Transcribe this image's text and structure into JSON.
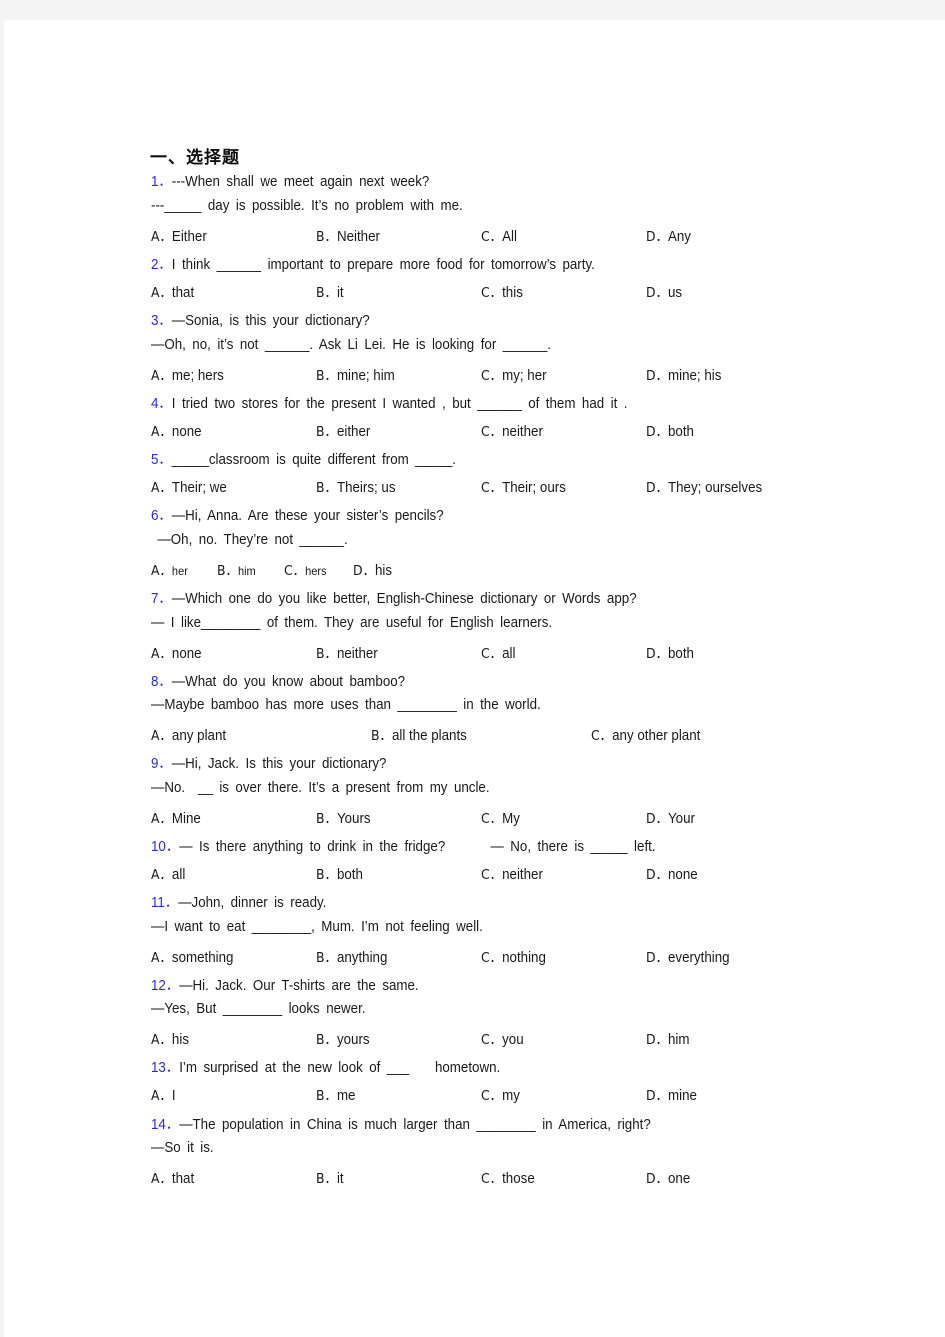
{
  "section_title": "一、选择题",
  "questions": [
    {
      "num": "1．",
      "lines": [
        "---When shall we meet again next week?",
        "---_____ day is possible. It’s no problem with me."
      ],
      "options": [
        {
          "letter": "A．",
          "text": "Either"
        },
        {
          "letter": "B．",
          "text": "Neither"
        },
        {
          "letter": "C．",
          "text": "All"
        },
        {
          "letter": "D．",
          "text": "Any"
        }
      ]
    },
    {
      "num": "2．",
      "lines": [
        "I think ______ important to prepare more food for tomorrow’s party."
      ],
      "options": [
        {
          "letter": "A．",
          "text": "that"
        },
        {
          "letter": "B．",
          "text": "it"
        },
        {
          "letter": "C．",
          "text": "this"
        },
        {
          "letter": "D．",
          "text": "us"
        }
      ]
    },
    {
      "num": "3．",
      "lines": [
        "—Sonia, is this your dictionary?",
        "—Oh, no, it’s not ______. Ask Li Lei. He is looking for ______."
      ],
      "options": [
        {
          "letter": "A．",
          "text": "me; hers"
        },
        {
          "letter": "B．",
          "text": "mine; him"
        },
        {
          "letter": "C．",
          "text": "my; her"
        },
        {
          "letter": "D．",
          "text": "mine; his"
        }
      ]
    },
    {
      "num": "4．",
      "lines": [
        "I tried two stores for the present I wanted , but ______ of them had it ."
      ],
      "options": [
        {
          "letter": "A．",
          "text": "none"
        },
        {
          "letter": "B．",
          "text": "either"
        },
        {
          "letter": "C．",
          "text": "neither"
        },
        {
          "letter": "D．",
          "text": "both"
        }
      ]
    },
    {
      "num": "5．",
      "lines": [
        "_____classroom is quite different from _____."
      ],
      "options": [
        {
          "letter": "A．",
          "text": "Their; we"
        },
        {
          "letter": "B．",
          "text": "Theirs; us"
        },
        {
          "letter": "C．",
          "text": "Their; ours"
        },
        {
          "letter": "D．",
          "text": "They; ourselves"
        }
      ]
    },
    {
      "num": "6．",
      "lines": [
        "—Hi, Anna. Are these your sister’s pencils?",
        " —Oh, no. They’re not ______."
      ],
      "options": [
        {
          "letter": "A．",
          "text": "her"
        },
        {
          "letter": "B．",
          "text": "him"
        },
        {
          "letter": "C．",
          "text": "hers"
        },
        {
          "letter": "D．",
          "text": "his"
        }
      ]
    },
    {
      "num": "7．",
      "lines": [
        "—Which one do you like better, English-Chinese dictionary or Words app?",
        "— I like________ of them. They are useful for English learners."
      ],
      "options": [
        {
          "letter": "A．",
          "text": "none"
        },
        {
          "letter": "B．",
          "text": "neither"
        },
        {
          "letter": "C．",
          "text": "all"
        },
        {
          "letter": "D．",
          "text": "both"
        }
      ]
    },
    {
      "num": "8．",
      "lines": [
        "—What do you know about bamboo?",
        "—Maybe bamboo has more uses than ________ in the world."
      ],
      "options": [
        {
          "letter": "A．",
          "text": "any plant"
        },
        {
          "letter": "B．",
          "text": "all the plants"
        },
        {
          "letter": "C．",
          "text": "any other plant"
        }
      ]
    },
    {
      "num": "9．",
      "lines": [
        "—Hi, Jack. Is this your dictionary?",
        "—No.  __ is over there. It’s a present from my uncle."
      ],
      "options": [
        {
          "letter": "A．",
          "text": "Mine"
        },
        {
          "letter": "B．",
          "text": "Yours"
        },
        {
          "letter": "C．",
          "text": "My"
        },
        {
          "letter": "D．",
          "text": "Your"
        }
      ]
    },
    {
      "num": "10．",
      "lines": [
        "— Is there anything to drink in the fridge?       — No, there is _____ left."
      ],
      "options": [
        {
          "letter": "A．",
          "text": "all"
        },
        {
          "letter": "B．",
          "text": "both"
        },
        {
          "letter": "C．",
          "text": "neither"
        },
        {
          "letter": "D．",
          "text": "none"
        }
      ]
    },
    {
      "num": "11．",
      "lines": [
        "—John, dinner is ready.",
        "—I want to eat ________, Mum. I’m not feeling well."
      ],
      "options": [
        {
          "letter": "A．",
          "text": "something"
        },
        {
          "letter": "B．",
          "text": "anything"
        },
        {
          "letter": "C．",
          "text": "nothing"
        },
        {
          "letter": "D．",
          "text": "everything"
        }
      ]
    },
    {
      "num": "12．",
      "lines": [
        "—Hi. Jack. Our T-shirts are the same.",
        "—Yes, But ________ looks newer."
      ],
      "options": [
        {
          "letter": "A．",
          "text": "his"
        },
        {
          "letter": "B．",
          "text": "yours"
        },
        {
          "letter": "C．",
          "text": "you"
        },
        {
          "letter": "D．",
          "text": "him"
        }
      ]
    },
    {
      "num": "13．",
      "lines": [
        "I’m surprised at the new look of ___    hometown."
      ],
      "options": [
        {
          "letter": "A．",
          "text": "I"
        },
        {
          "letter": "B．",
          "text": "me"
        },
        {
          "letter": "C．",
          "text": "my"
        },
        {
          "letter": "D．",
          "text": "mine"
        }
      ]
    },
    {
      "num": "14．",
      "lines": [
        "—The population in China is much larger than ________ in America, right?",
        "—So it is."
      ],
      "options": [
        {
          "letter": "A．",
          "text": "that"
        },
        {
          "letter": "B．",
          "text": "it"
        },
        {
          "letter": "C．",
          "text": "those"
        },
        {
          "letter": "D．",
          "text": "one"
        }
      ]
    }
  ]
}
